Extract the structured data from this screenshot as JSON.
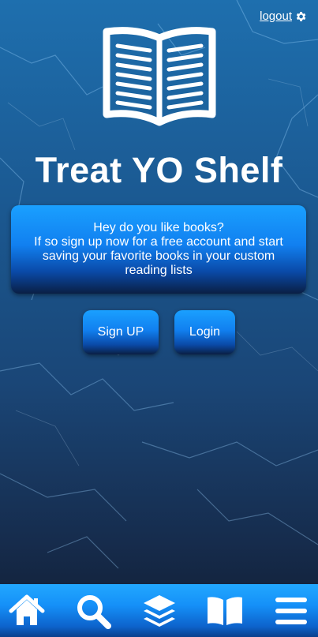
{
  "header": {
    "logout_label": "logout",
    "logout_icon": "gear-icon"
  },
  "app": {
    "title": "Treat YO Shelf",
    "logo_icon": "open-book-icon"
  },
  "promo": {
    "text": "Hey do you like books?\nIf so sign up now for a free account and start saving your favorite books in your custom reading lists"
  },
  "buttons": {
    "signup_label": "Sign UP",
    "login_label": "Login"
  },
  "navbar": {
    "items": [
      {
        "icon": "home-icon"
      },
      {
        "icon": "search-icon"
      },
      {
        "icon": "layers-icon"
      },
      {
        "icon": "book-icon"
      },
      {
        "icon": "menu-icon"
      }
    ]
  },
  "colors": {
    "accent": "#1180f0",
    "accent_light": "#1aa0ff",
    "background_dark": "#162c4d",
    "text": "#ffffff"
  }
}
